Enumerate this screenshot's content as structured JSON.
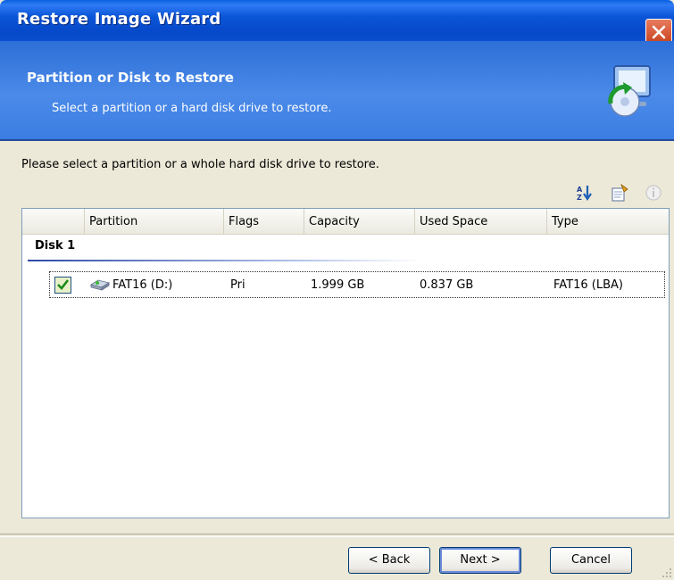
{
  "window": {
    "title": "Restore Image Wizard"
  },
  "header": {
    "title": "Partition or Disk to Restore",
    "subtitle": "Select a partition or a hard disk drive to restore."
  },
  "instruction": "Please select a partition or a whole hard disk drive to restore.",
  "toolbar": {
    "icons": [
      "sort-icon",
      "properties-icon",
      "info-icon"
    ]
  },
  "table": {
    "columns": [
      "Partition",
      "Flags",
      "Capacity",
      "Used Space",
      "Type"
    ],
    "groups": [
      {
        "name": "Disk 1",
        "rows": [
          {
            "checked": true,
            "partition": "FAT16 (D:)",
            "flags": "Pri",
            "capacity": "1.999 GB",
            "used_space": "0.837 GB",
            "type": "FAT16 (LBA)"
          }
        ]
      }
    ]
  },
  "buttons": {
    "back": "< Back",
    "next": "Next >",
    "cancel": "Cancel"
  },
  "colors": {
    "title_bar": "#0a4fd0",
    "header_band": "#3b7de3",
    "dialog_bg": "#ece9d8",
    "close_button": "#d4562f"
  }
}
